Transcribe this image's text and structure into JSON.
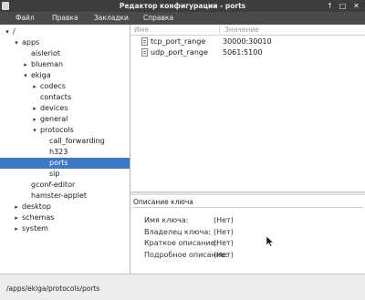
{
  "window": {
    "title": "Редактор конфигурации - ports",
    "icons": [
      "app-icon",
      "arrow-up-icon",
      "maximize-icon",
      "close-icon"
    ]
  },
  "menu": [
    "Файл",
    "Правка",
    "Закладки",
    "Справка"
  ],
  "tree": [
    {
      "label": "/",
      "expanded": true,
      "has_children": true
    },
    {
      "label": "apps",
      "expanded": true,
      "has_children": true
    },
    {
      "label": "aisleriot",
      "has_children": false
    },
    {
      "label": "blueman",
      "has_children": true
    },
    {
      "label": "ekiga",
      "expanded": true,
      "has_children": true
    },
    {
      "label": "codecs",
      "has_children": true
    },
    {
      "label": "contacts",
      "has_children": false
    },
    {
      "label": "devices",
      "has_children": true
    },
    {
      "label": "general",
      "has_children": true
    },
    {
      "label": "protocols",
      "expanded": true,
      "has_children": true
    },
    {
      "label": "call_forwarding",
      "has_children": false
    },
    {
      "label": "h323",
      "has_children": false
    },
    {
      "label": "ports",
      "has_children": false,
      "selected": true
    },
    {
      "label": "sip",
      "has_children": false
    },
    {
      "label": "gconf-editor",
      "has_children": false
    },
    {
      "label": "hamster-applet",
      "has_children": false
    },
    {
      "label": "desktop",
      "has_children": true
    },
    {
      "label": "schemas",
      "has_children": true
    },
    {
      "label": "system",
      "has_children": true
    }
  ],
  "columns": {
    "name": "Имя",
    "value": "Значение"
  },
  "keys": [
    {
      "name": "tcp_port_range",
      "value": "30000:30010"
    },
    {
      "name": "udp_port_range",
      "value": "5061:5100"
    }
  ],
  "description": {
    "title": "Описание ключа",
    "rows": [
      {
        "label": "Имя ключа:",
        "value": "(Нет)"
      },
      {
        "label": "Владелец ключа:",
        "value": "(Нет)"
      },
      {
        "label": "Краткое описание:",
        "value": "(Нет)"
      },
      {
        "label": "Подробное описание:",
        "value": "(Нет)"
      }
    ]
  },
  "status": {
    "path": "/apps/ekiga/protocols/ports"
  },
  "colors": {
    "selection": "#3b78c9",
    "titlebar": "#3c3c3c",
    "menubar": "#4a4a4a"
  }
}
